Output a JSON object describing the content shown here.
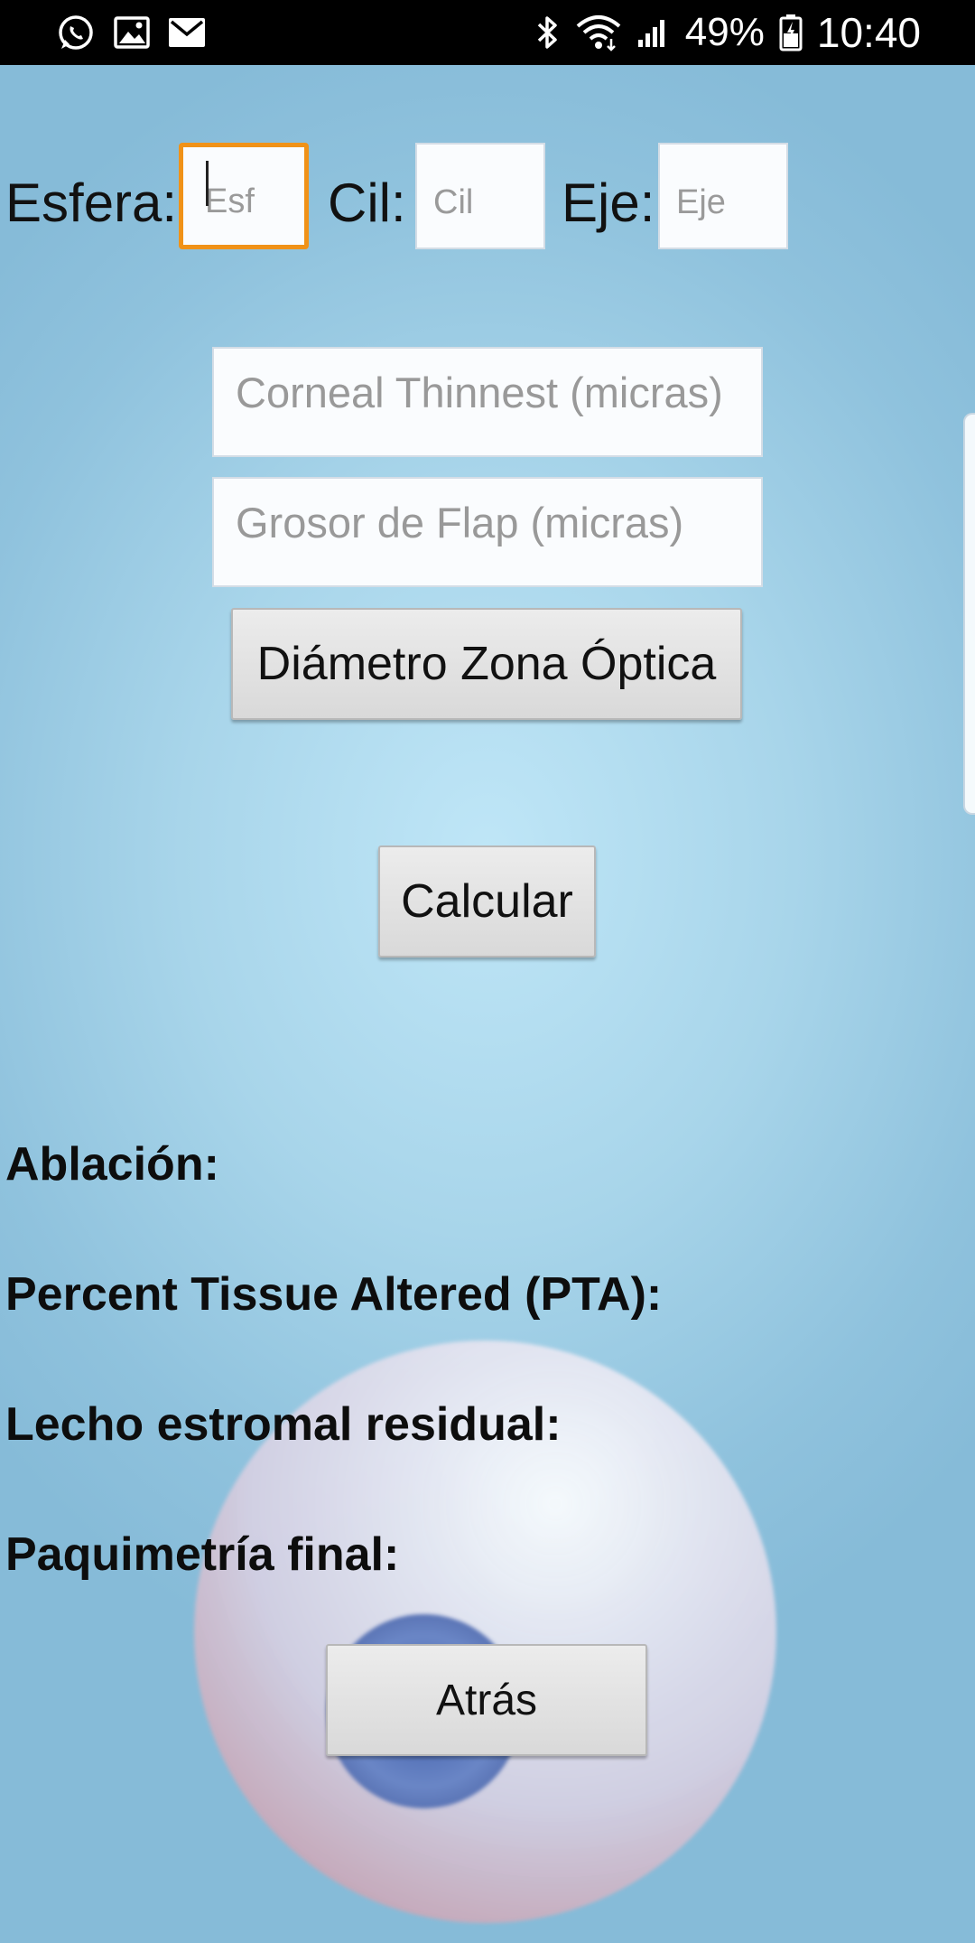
{
  "status_bar": {
    "left_icons": [
      "whatsapp-icon",
      "gallery-icon",
      "email-icon"
    ],
    "right_icons": [
      "bluetooth-icon",
      "wifi-icon",
      "signal-icon",
      "battery-icon"
    ],
    "battery_percent": "49%",
    "time": "10:40"
  },
  "form": {
    "esfera_label": "Esfera:",
    "esfera_placeholder": "Esf",
    "cil_label": "Cil:",
    "cil_placeholder": "Cil",
    "eje_label": "Eje:",
    "eje_placeholder": "Eje",
    "corneal_thinnest_placeholder": "Corneal Thinnest (micras)",
    "grosor_flap_placeholder": "Grosor de Flap (micras)",
    "diametro_button": "Diámetro Zona Óptica",
    "calcular_button": "Calcular"
  },
  "results": {
    "ablacion_label": "Ablación:",
    "pta_label": "Percent Tissue Altered (PTA):",
    "lecho_label": "Lecho estromal residual:",
    "paquimetria_label": "Paquimetría final:"
  },
  "navigation": {
    "atras_button": "Atrás"
  },
  "colors": {
    "focus_border": "#f09218",
    "background": "#a8d5ea"
  }
}
